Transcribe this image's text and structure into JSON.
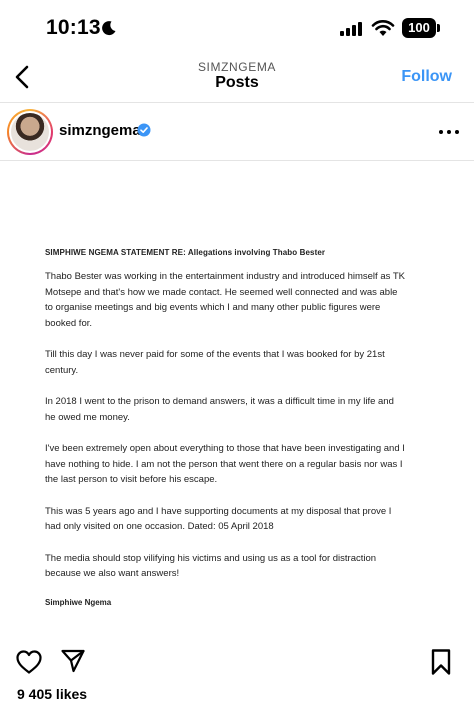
{
  "status_bar": {
    "time": "10:13",
    "battery": "100"
  },
  "nav": {
    "subtitle": "SIMZNGEMA",
    "title": "Posts",
    "follow_label": "Follow"
  },
  "post": {
    "username": "simzngema",
    "likes": "9 405 likes"
  },
  "statement": {
    "heading": "SIMPHIWE NGEMA STATEMENT RE: Allegations involving Thabo Bester",
    "paragraphs": [
      "Thabo Bester was working in the entertainment industry and introduced himself as TK\nMotsepe and that's how we made contact. He seemed well connected and was able\nto organise meetings and big events which I and many other public figures were\nbooked for.",
      "Till this day I was never paid for some of the events that I was booked for by 21st\ncentury.",
      "In 2018 I went to the prison to demand answers, it was a difficult time in my life and\nhe owed me money.",
      "I've been extremely open about everything to those that have been investigating and I\nhave nothing to hide. I am not the person that went there on a regular basis nor was I\nthe last person to visit before his escape.",
      "This was 5 years ago and I have supporting documents at my disposal that prove I\nhad only visited on one occasion. Dated: 05 April 2018",
      "The media should stop vilifying his victims and using us as a tool for distraction\nbecause we also want answers!"
    ],
    "signature": "Simphiwe Ngema"
  },
  "icons": {
    "moon": "moon-icon",
    "signal": "cellular-signal-icon",
    "wifi": "wifi-icon",
    "battery": "battery-icon",
    "back": "chevron-left-icon",
    "verified": "verified-badge-icon",
    "more": "more-horizontal-icon",
    "like": "heart-icon",
    "share": "paper-plane-icon",
    "save": "bookmark-icon"
  },
  "colors": {
    "accent": "#3b95f6",
    "verified": "#3b95f6"
  }
}
